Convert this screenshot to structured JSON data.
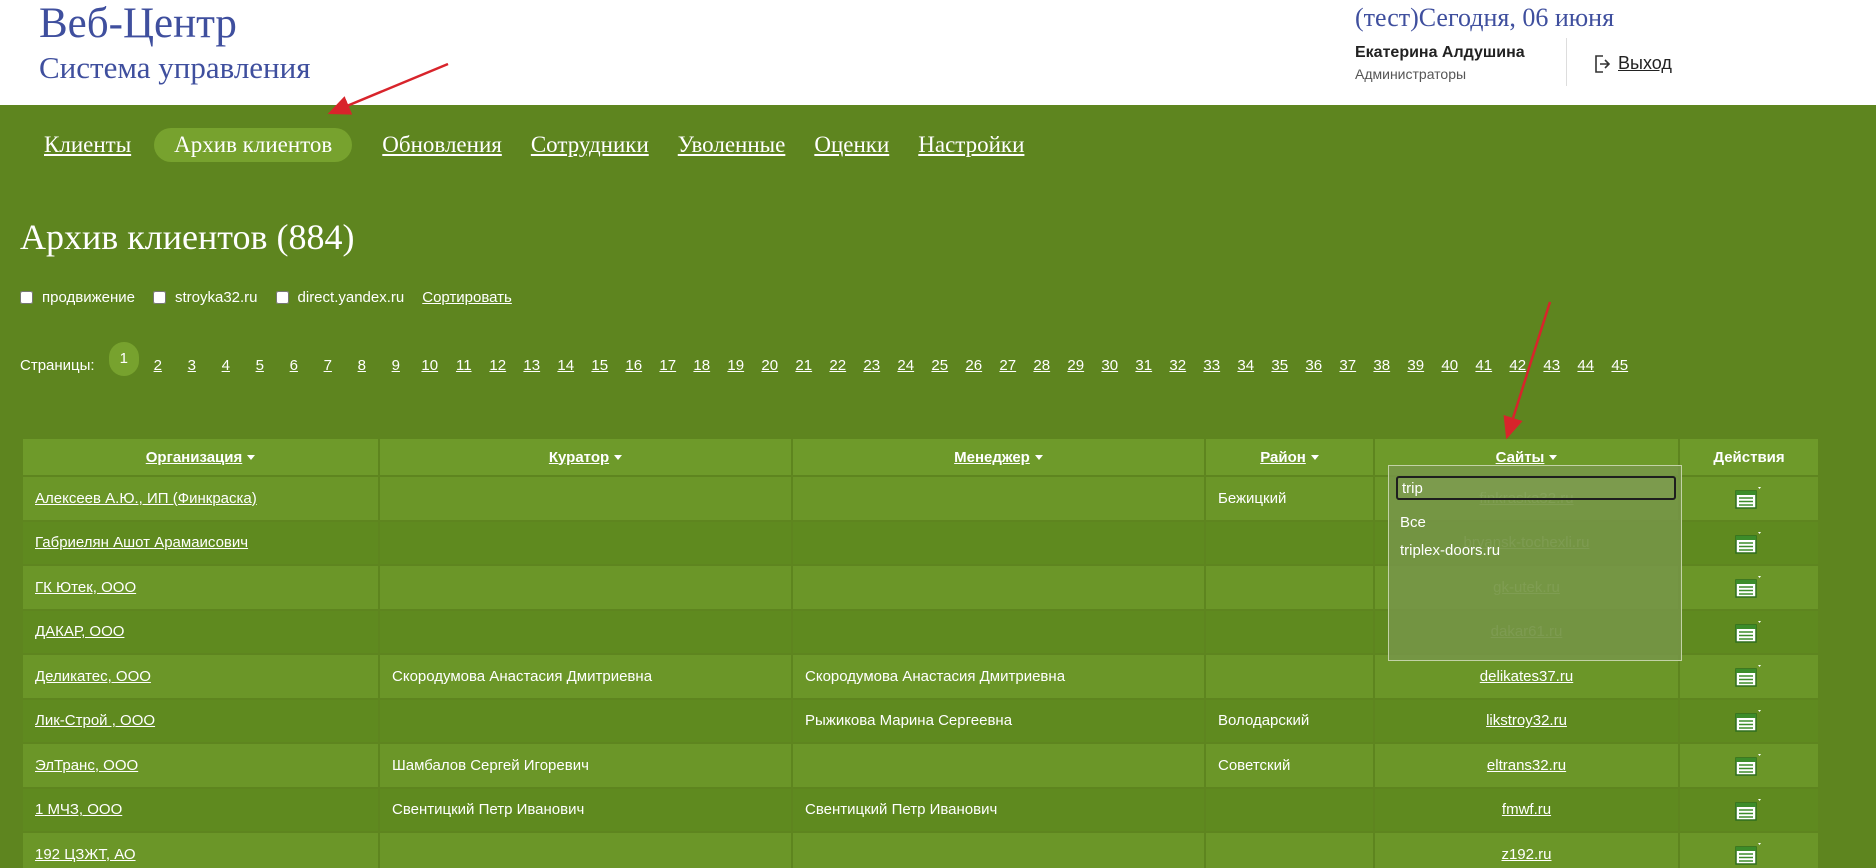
{
  "header": {
    "logo_title": "Веб-Центр",
    "logo_subtitle": "Система управления",
    "today": "(тест)Сегодня, 06 июня",
    "user_name": "Екатерина Алдушина",
    "user_role": "Администраторы",
    "logout_label": "Выход"
  },
  "nav": {
    "items": [
      "Клиенты",
      "Архив клиентов",
      "Обновления",
      "Сотрудники",
      "Уволенные",
      "Оценки",
      "Настройки"
    ],
    "active": "Архив клиентов"
  },
  "page_title": "Архив клиентов (884)",
  "filters": {
    "checkbox_1": "продвижение",
    "checkbox_2": "stroyka32.ru",
    "checkbox_3": "direct.yandex.ru",
    "sort_label": "Сортировать"
  },
  "pagination": {
    "label": "Страницы:",
    "current": "1",
    "pages": [
      "1",
      "2",
      "3",
      "4",
      "5",
      "6",
      "7",
      "8",
      "9",
      "10",
      "11",
      "12",
      "13",
      "14",
      "15",
      "16",
      "17",
      "18",
      "19",
      "20",
      "21",
      "22",
      "23",
      "24",
      "25",
      "26",
      "27",
      "28",
      "29",
      "30",
      "31",
      "32",
      "33",
      "34",
      "35",
      "36",
      "37",
      "38",
      "39",
      "40",
      "41",
      "42",
      "43",
      "44",
      "45"
    ]
  },
  "table": {
    "headers": [
      "Организация",
      "Куратор",
      "Менеджер",
      "Район",
      "Сайты",
      "Действия"
    ],
    "rows": [
      {
        "org": "Алексеев А.Ю., ИП (Финкраска)",
        "curator": "",
        "manager": "",
        "district": "Бежицкий",
        "site": "finkraska32.ru"
      },
      {
        "org": "Габриелян Ашот Арамаисович",
        "curator": "",
        "manager": "",
        "district": "",
        "site": "bryansk-tochexli.ru"
      },
      {
        "org": "ГК Ютек, ООО",
        "curator": "",
        "manager": "",
        "district": "",
        "site": "gk-utek.ru"
      },
      {
        "org": "ДАКАР, ООО",
        "curator": "",
        "manager": "",
        "district": "",
        "site": "dakar61.ru"
      },
      {
        "org": "Деликатес, ООО",
        "curator": "Скородумова Анастасия Дмитриевна",
        "manager": "Скородумова Анастасия Дмитриевна",
        "district": "",
        "site": "delikates37.ru"
      },
      {
        "org": "Лик-Строй , ООО",
        "curator": "",
        "manager": "Рыжикова Марина Сергеевна",
        "district": "Володарский",
        "site": "likstroy32.ru"
      },
      {
        "org": "ЭлТранс, ООО",
        "curator": "Шамбалов Сергей Игоревич",
        "manager": "",
        "district": "Советский",
        "site": "eltrans32.ru"
      },
      {
        "org": "1 МЧЗ, ООО",
        "curator": "Свентицкий Петр Иванович",
        "manager": "Свентицкий Петр Иванович",
        "district": "",
        "site": "fmwf.ru"
      },
      {
        "org": "192 ЦЗЖТ, АО",
        "curator": "",
        "manager": "",
        "district": "",
        "site": "z192.ru"
      }
    ]
  },
  "site_filter_popup": {
    "input_value": "trip",
    "options": [
      "Все",
      "triplex-doors.ru"
    ]
  }
}
